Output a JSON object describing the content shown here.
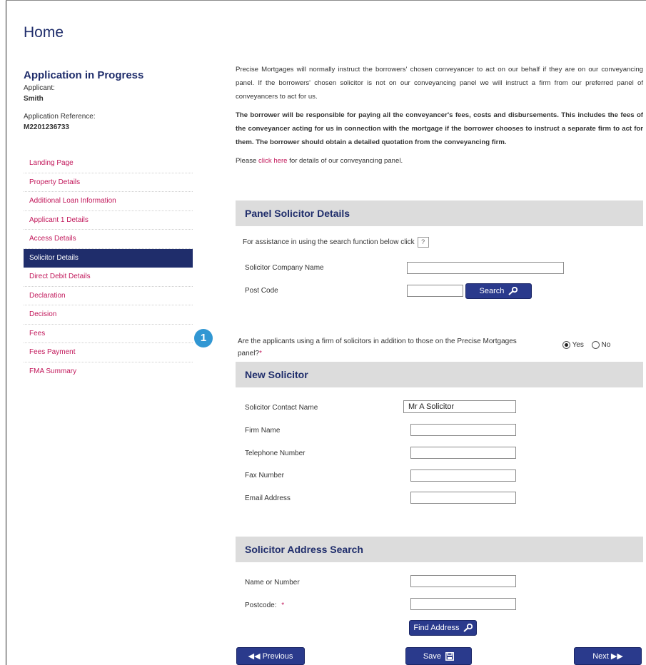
{
  "page": {
    "title": "Home"
  },
  "sidebar": {
    "heading": "Application in Progress",
    "applicant_label": "Applicant:",
    "applicant_value": "Smith",
    "reference_label": "Application Reference:",
    "reference_value": "M2201236733",
    "items": [
      {
        "label": "Landing Page"
      },
      {
        "label": "Property Details"
      },
      {
        "label": "Additional Loan Information"
      },
      {
        "label": "Applicant 1 Details"
      },
      {
        "label": "Access Details"
      },
      {
        "label": "Solicitor Details",
        "active": true
      },
      {
        "label": "Direct Debit Details"
      },
      {
        "label": "Declaration"
      },
      {
        "label": "Decision"
      },
      {
        "label": "Fees"
      },
      {
        "label": "Fees Payment"
      },
      {
        "label": "FMA Summary"
      }
    ]
  },
  "step_badge": "1",
  "intro": {
    "p1": "Precise Mortgages will normally instruct the borrowers' chosen conveyancer to act on our behalf if they are on our conveyancing panel. If the borrowers' chosen solicitor is not on our conveyancing panel we will instruct a firm from our preferred panel of conveyancers to act for us.",
    "p2": "The borrower will be responsible for paying all the conveyancer's fees, costs and disbursements. This includes the fees of the conveyancer acting for us in connection with the mortgage if the borrower chooses to instruct a separate firm to act for them. The borrower should obtain a detailed quotation from the conveyancing firm.",
    "p3_before": "Please ",
    "p3_link": "click here",
    "p3_after": " for details of our conveyancing panel."
  },
  "panel_section": {
    "title": "Panel Solicitor Details",
    "assist_text": "For assistance in using the search function below click",
    "help_label": "?",
    "company_label": "Solicitor Company Name",
    "company_value": "",
    "postcode_label": "Post Code",
    "postcode_value": "",
    "search_button": "Search"
  },
  "question": {
    "text": "Are the applicants using a firm of solicitors in addition to those on the Precise Mortgages panel?",
    "required_mark": "*",
    "yes_label": "Yes",
    "no_label": "No",
    "selected": "Yes"
  },
  "new_solicitor": {
    "title": "New Solicitor",
    "fields": [
      {
        "label": "Solicitor Contact Name",
        "value": "Mr A Solicitor"
      },
      {
        "label": "Firm Name",
        "value": ""
      },
      {
        "label": "Telephone Number",
        "value": ""
      },
      {
        "label": "Fax Number",
        "value": ""
      },
      {
        "label": "Email Address",
        "value": ""
      }
    ]
  },
  "address_search": {
    "title": "Solicitor Address Search",
    "name_label": "Name or Number",
    "name_value": "",
    "postcode_label": "Postcode:",
    "postcode_required": "*",
    "postcode_value": "",
    "find_button": "Find Address"
  },
  "footer": {
    "previous": "Previous",
    "save": "Save",
    "next": "Next"
  }
}
